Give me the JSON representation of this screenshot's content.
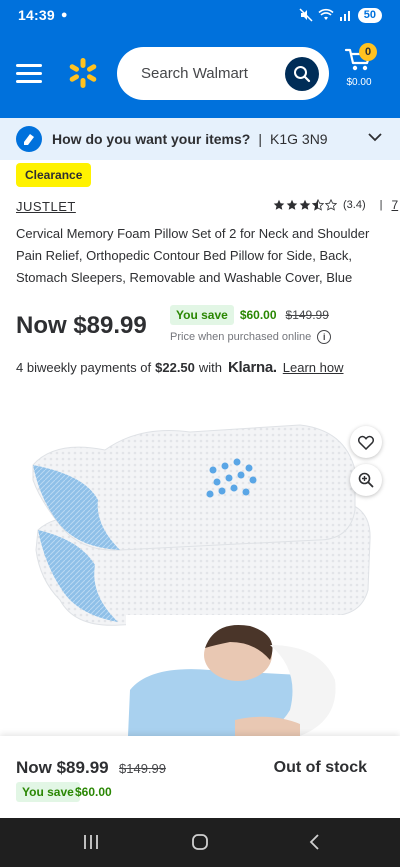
{
  "status_bar": {
    "time": "14:39",
    "battery": "50"
  },
  "header": {
    "search": {
      "placeholder": "Search Walmart"
    },
    "cart": {
      "count": "0",
      "total": "$0.00"
    },
    "colors": {
      "primary": "#0071dc",
      "accent": "#ffc220"
    }
  },
  "delivery": {
    "question": "How do you want your items?",
    "separator": "|",
    "postal_code": "K1G 3N9"
  },
  "product": {
    "badge": "Clearance",
    "brand": "JUSTLET",
    "rating": {
      "value": "(3.4)",
      "stars": 3.5,
      "separator": "|",
      "review_count": "7"
    },
    "title": "Cervical Memory Foam Pillow Set of 2 for Neck and Shoulder Pain Relief, Orthopedic Contour Bed Pillow for Side, Back, Stomach Sleepers, Removable and Washable Cover, Blue",
    "now_price": "Now $89.99",
    "you_save_label": "You save",
    "save_amount": "$60.00",
    "was_price": "$149.99",
    "price_note": "Price when purchased online",
    "klarna": {
      "prefix": "4 biweekly payments of",
      "amount": "$22.50",
      "with": "with",
      "logo": "Klarna.",
      "learn": "Learn how"
    }
  },
  "sticky_bar": {
    "now_price": "Now $89.99",
    "was_price": "$149.99",
    "you_save_label": "You save",
    "save_amount": "$60.00",
    "status": "Out of stock"
  }
}
